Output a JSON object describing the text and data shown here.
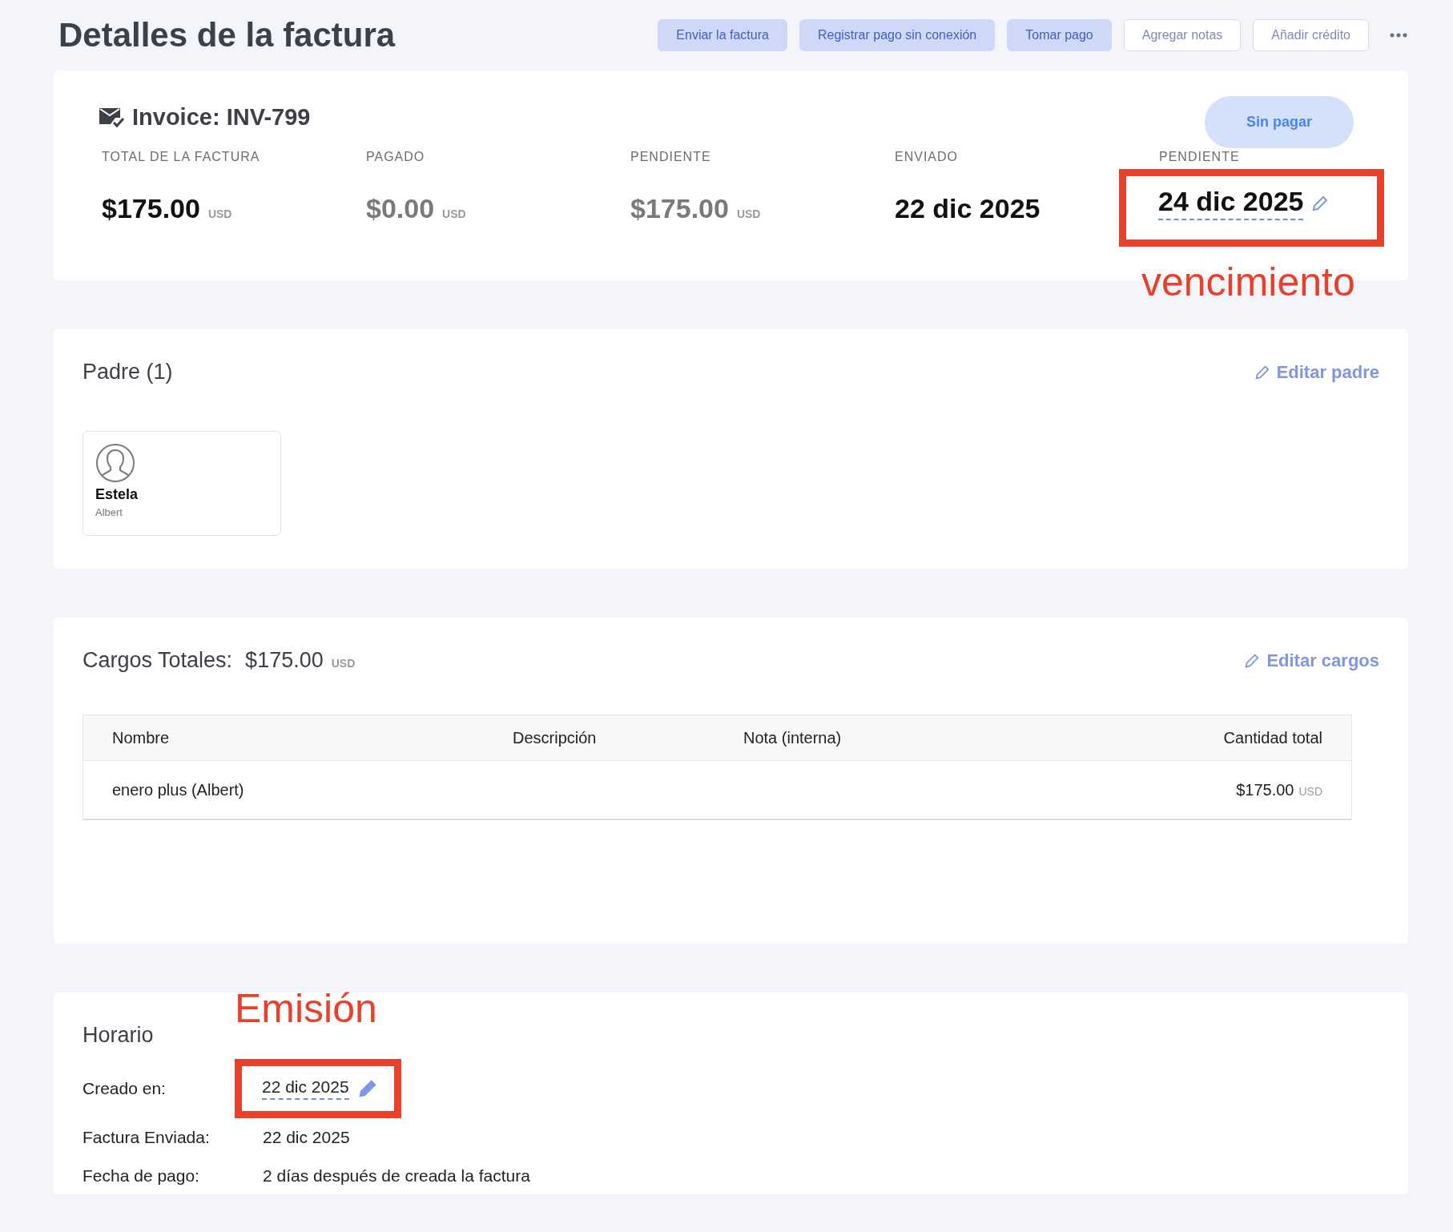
{
  "page": {
    "title": "Detalles de la factura",
    "actions": [
      {
        "label": "Enviar la factura",
        "kind": "filled"
      },
      {
        "label": "Registrar pago sin conexión",
        "kind": "filled"
      },
      {
        "label": "Tomar pago",
        "kind": "filled"
      },
      {
        "label": "Agregar notas",
        "kind": "outline"
      },
      {
        "label": "Añadir crédito",
        "kind": "outline"
      }
    ]
  },
  "invoice": {
    "title": "Invoice: INV-799",
    "status": "Sin pagar",
    "stats": [
      {
        "label": "TOTAL DE LA FACTURA",
        "kind": "amount",
        "value": "$175.00",
        "currency": "USD",
        "muted": false
      },
      {
        "label": "PAGADO",
        "kind": "amount",
        "value": "$0.00",
        "currency": "USD",
        "muted": true
      },
      {
        "label": "PENDIENTE",
        "kind": "amount",
        "value": "$175.00",
        "currency": "USD",
        "muted": true
      },
      {
        "label": "ENVIADO",
        "kind": "date",
        "value": "22 dic 2025",
        "muted": false
      },
      {
        "label": "PENDIENTE",
        "kind": "editable_date",
        "value": "24 dic 2025",
        "muted": false,
        "annotation": "vencimiento"
      }
    ]
  },
  "parents": {
    "title": "Padre (1)",
    "edit_link": "Editar padre",
    "items": [
      {
        "first_name": "Estela",
        "last_name": "Albert"
      }
    ]
  },
  "charges": {
    "title": "Cargos Totales:",
    "total": "$175.00",
    "currency": "USD",
    "edit_link": "Editar cargos",
    "columns": [
      "Nombre",
      "Descripción",
      "Nota (interna)",
      "Cantidad total"
    ],
    "rows": [
      {
        "name": "enero plus (Albert)",
        "amount": "$175.00",
        "currency": "USD"
      }
    ]
  },
  "schedule": {
    "title": "Horario",
    "rows": [
      {
        "label": "Creado en:",
        "value": "22 dic 2025",
        "editable": true,
        "annotation": "Emisión"
      },
      {
        "label": "Factura Enviada:",
        "value": "22 dic 2025",
        "editable": false
      },
      {
        "label": "Fecha de pago:",
        "value": "2 días después de creada la factura",
        "editable": false
      }
    ]
  }
}
